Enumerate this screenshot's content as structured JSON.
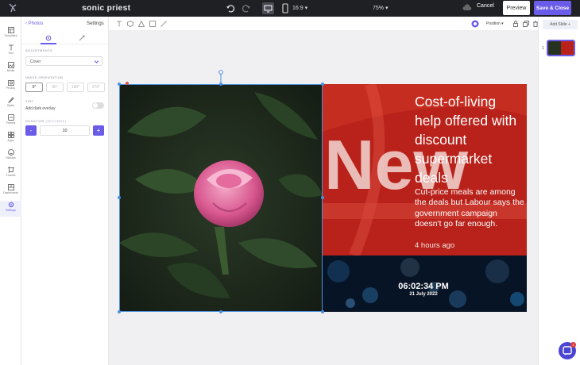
{
  "app": {
    "project_title": "sonic priest",
    "aspect_ratio": "16:9",
    "zoom": "75%",
    "cancel_label": "Cancel",
    "preview_label": "Preview",
    "save_label": "Save & Close"
  },
  "rail": {
    "items": [
      {
        "label": "Templates"
      },
      {
        "label": "Text"
      },
      {
        "label": "Media"
      },
      {
        "label": "Photos"
      },
      {
        "label": "Styles"
      },
      {
        "label": "Presets"
      },
      {
        "label": "Apps"
      },
      {
        "label": "Stickers"
      },
      {
        "label": "Frames"
      },
      {
        "label": "Dashboards"
      },
      {
        "label": "Settings"
      }
    ],
    "active": "Settings"
  },
  "panel": {
    "back_label": "Photos",
    "title": "Settings",
    "adjustments_label": "ADJUSTMENTS",
    "fit_value": "Cover",
    "orientation_label": "IMAGE ORIENTATION",
    "orientations": [
      "0°",
      "90°",
      "180°",
      "270°"
    ],
    "selected_orientation": "0°",
    "tint_label": "TINT",
    "overlay_label": "Add dark overlay",
    "duration_label": "DURATION",
    "duration_unit": "(SECONDS)",
    "duration_value": "10",
    "minus_label": "-",
    "plus_label": "+"
  },
  "toolbar": {
    "position_label": "Position"
  },
  "slides": {
    "add_label": "Add Slide",
    "slide_number": "1"
  },
  "canvas": {
    "headline": "Cost-of-living help offered with discount supermarket deals",
    "subline": "Cut-price meals are among the deals but Labour says the government campaign doesn't go far enough.",
    "time_ago": "4 hours ago",
    "clock": "06:02:34 PM",
    "date": "21 July 2022",
    "bg_word": "New"
  },
  "colors": {
    "accent": "#6a5ce8",
    "topbar": "#1f2024",
    "news_red": "#b8221a",
    "selection": "#4a8fe0"
  }
}
